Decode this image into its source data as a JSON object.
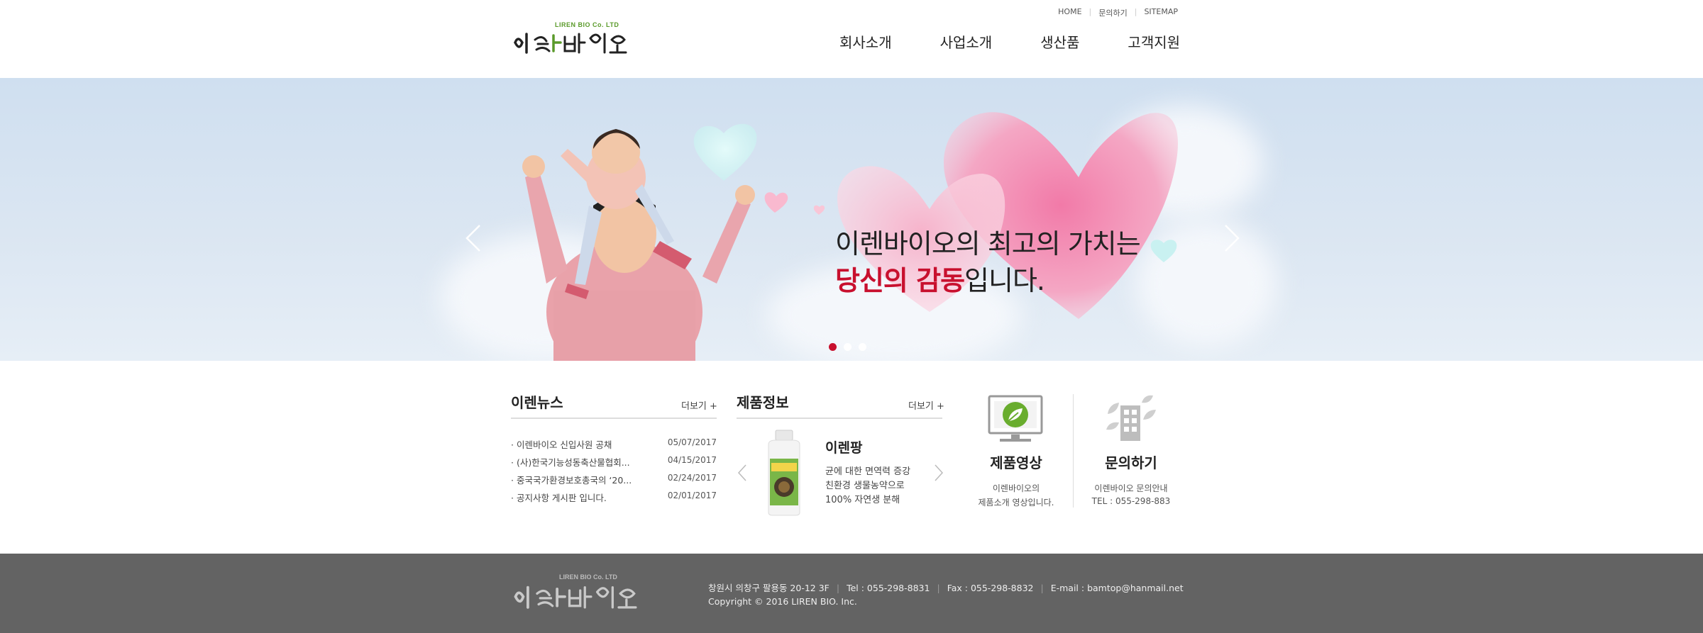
{
  "header": {
    "util_links": [
      "HOME",
      "문의하기",
      "SITEMAP"
    ],
    "logo_sub": "LIREN BIO Co. LTD",
    "logo_text": "이렌바이오",
    "nav": [
      "회사소개",
      "사업소개",
      "생산품",
      "고객지원"
    ]
  },
  "hero": {
    "line1": "이렌바이오의 최고의 가치는",
    "line2_highlight": "당신의 감동",
    "line2_rest": "입니다.",
    "slides": 3,
    "active_slide": 1
  },
  "news": {
    "title": "이렌뉴스",
    "more": "더보기 +",
    "items": [
      {
        "title": "이렌바이오 신입사원 공채",
        "date": "05/07/2017"
      },
      {
        "title": "(사)한국기능성동축산물협회...",
        "date": "04/15/2017"
      },
      {
        "title": "중국국가환경보호총국의 ‘20...",
        "date": "02/24/2017"
      },
      {
        "title": "공지사항 게시판 입니다.",
        "date": "02/01/2017"
      }
    ]
  },
  "products": {
    "title": "제품정보",
    "more": "더보기 +",
    "name": "이렌팡",
    "desc": [
      "균에 대한 면역력 증강",
      "친환경 생물농약으로",
      "100% 자연생 분해"
    ]
  },
  "video": {
    "title": "제품영상",
    "desc": [
      "이렌바이오의",
      "제품소개 영상입니다."
    ]
  },
  "contact": {
    "title": "문의하기",
    "desc": [
      "이렌바이오 문의안내",
      "TEL : 055-298-883"
    ]
  },
  "footer": {
    "logo_sub": "LIREN BIO Co. LTD",
    "logo_text": "이렌바이오",
    "address": "창원시 의창구 팔용동 20-12 3F",
    "tel": "Tel : 055-298-8831",
    "fax": "Fax : 055-298-8832",
    "email": "E-mail : bamtop@hanmail.net",
    "copyright": "Copyright © 2016 LIREN BIO. Inc."
  },
  "colors": {
    "accent": "#c8102e",
    "footer_bg": "#636363",
    "hero_bg": "#d7e4f1"
  }
}
